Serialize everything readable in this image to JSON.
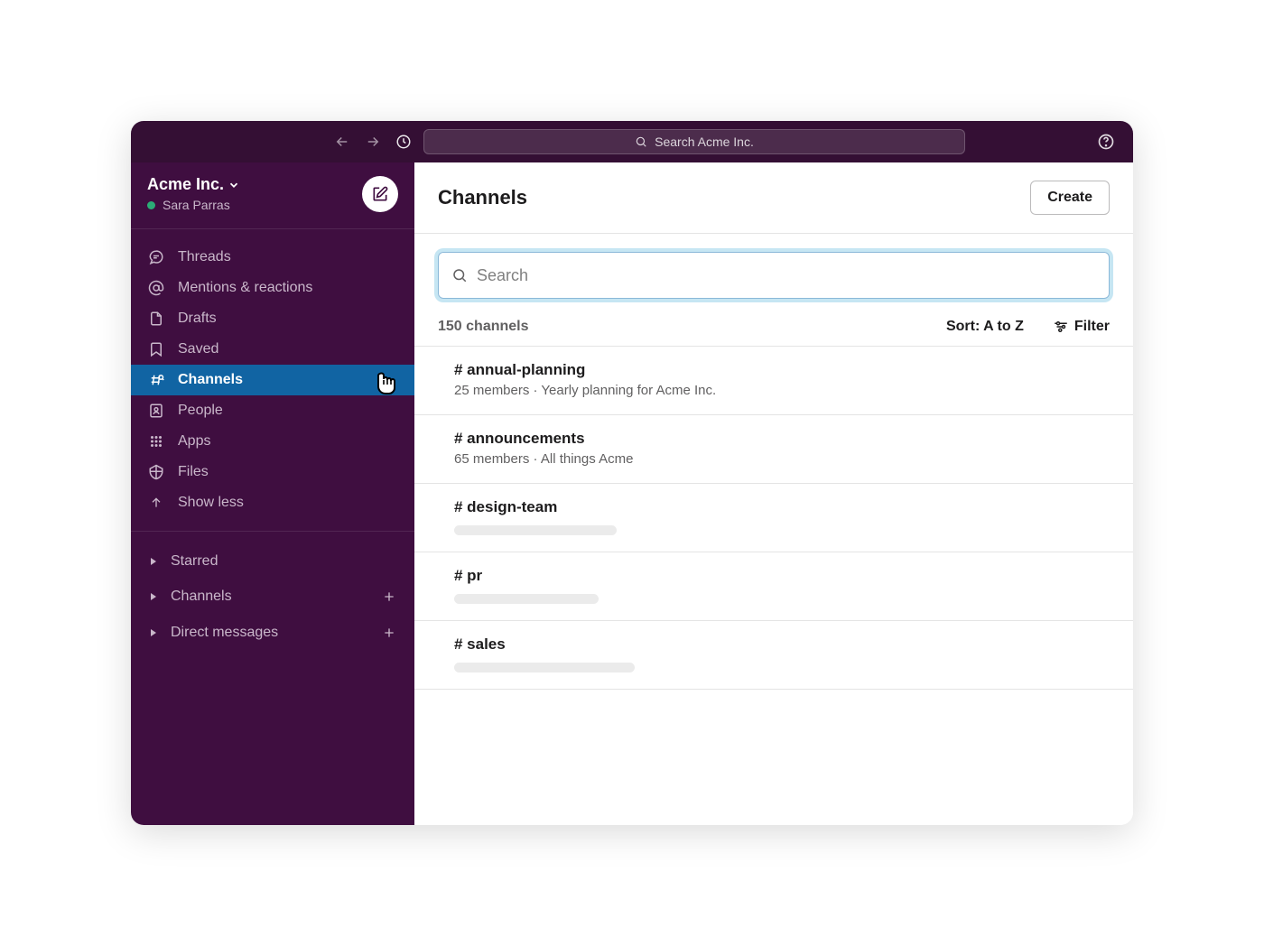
{
  "topbar": {
    "search_placeholder": "Search Acme Inc."
  },
  "workspace": {
    "name": "Acme Inc.",
    "user": "Sara Parras"
  },
  "nav": {
    "threads": "Threads",
    "mentions": "Mentions & reactions",
    "drafts": "Drafts",
    "saved": "Saved",
    "channels": "Channels",
    "people": "People",
    "apps": "Apps",
    "files": "Files",
    "show_less": "Show less"
  },
  "sections": {
    "starred": "Starred",
    "channels": "Channels",
    "dms": "Direct messages"
  },
  "main": {
    "title": "Channels",
    "create_label": "Create",
    "search_placeholder": "Search",
    "count_label": "150 channels",
    "sort_label": "Sort: A to Z",
    "filter_label": "Filter"
  },
  "channels": [
    {
      "name": "# annual-planning",
      "meta": "25 members  · Yearly planning for Acme Inc.",
      "placeholder_width": 0
    },
    {
      "name": "# announcements",
      "meta": "65 members  · All things Acme",
      "placeholder_width": 0
    },
    {
      "name": "# design-team",
      "meta": "",
      "placeholder_width": 180
    },
    {
      "name": "# pr",
      "meta": "",
      "placeholder_width": 160
    },
    {
      "name": "# sales",
      "meta": "",
      "placeholder_width": 200
    }
  ]
}
